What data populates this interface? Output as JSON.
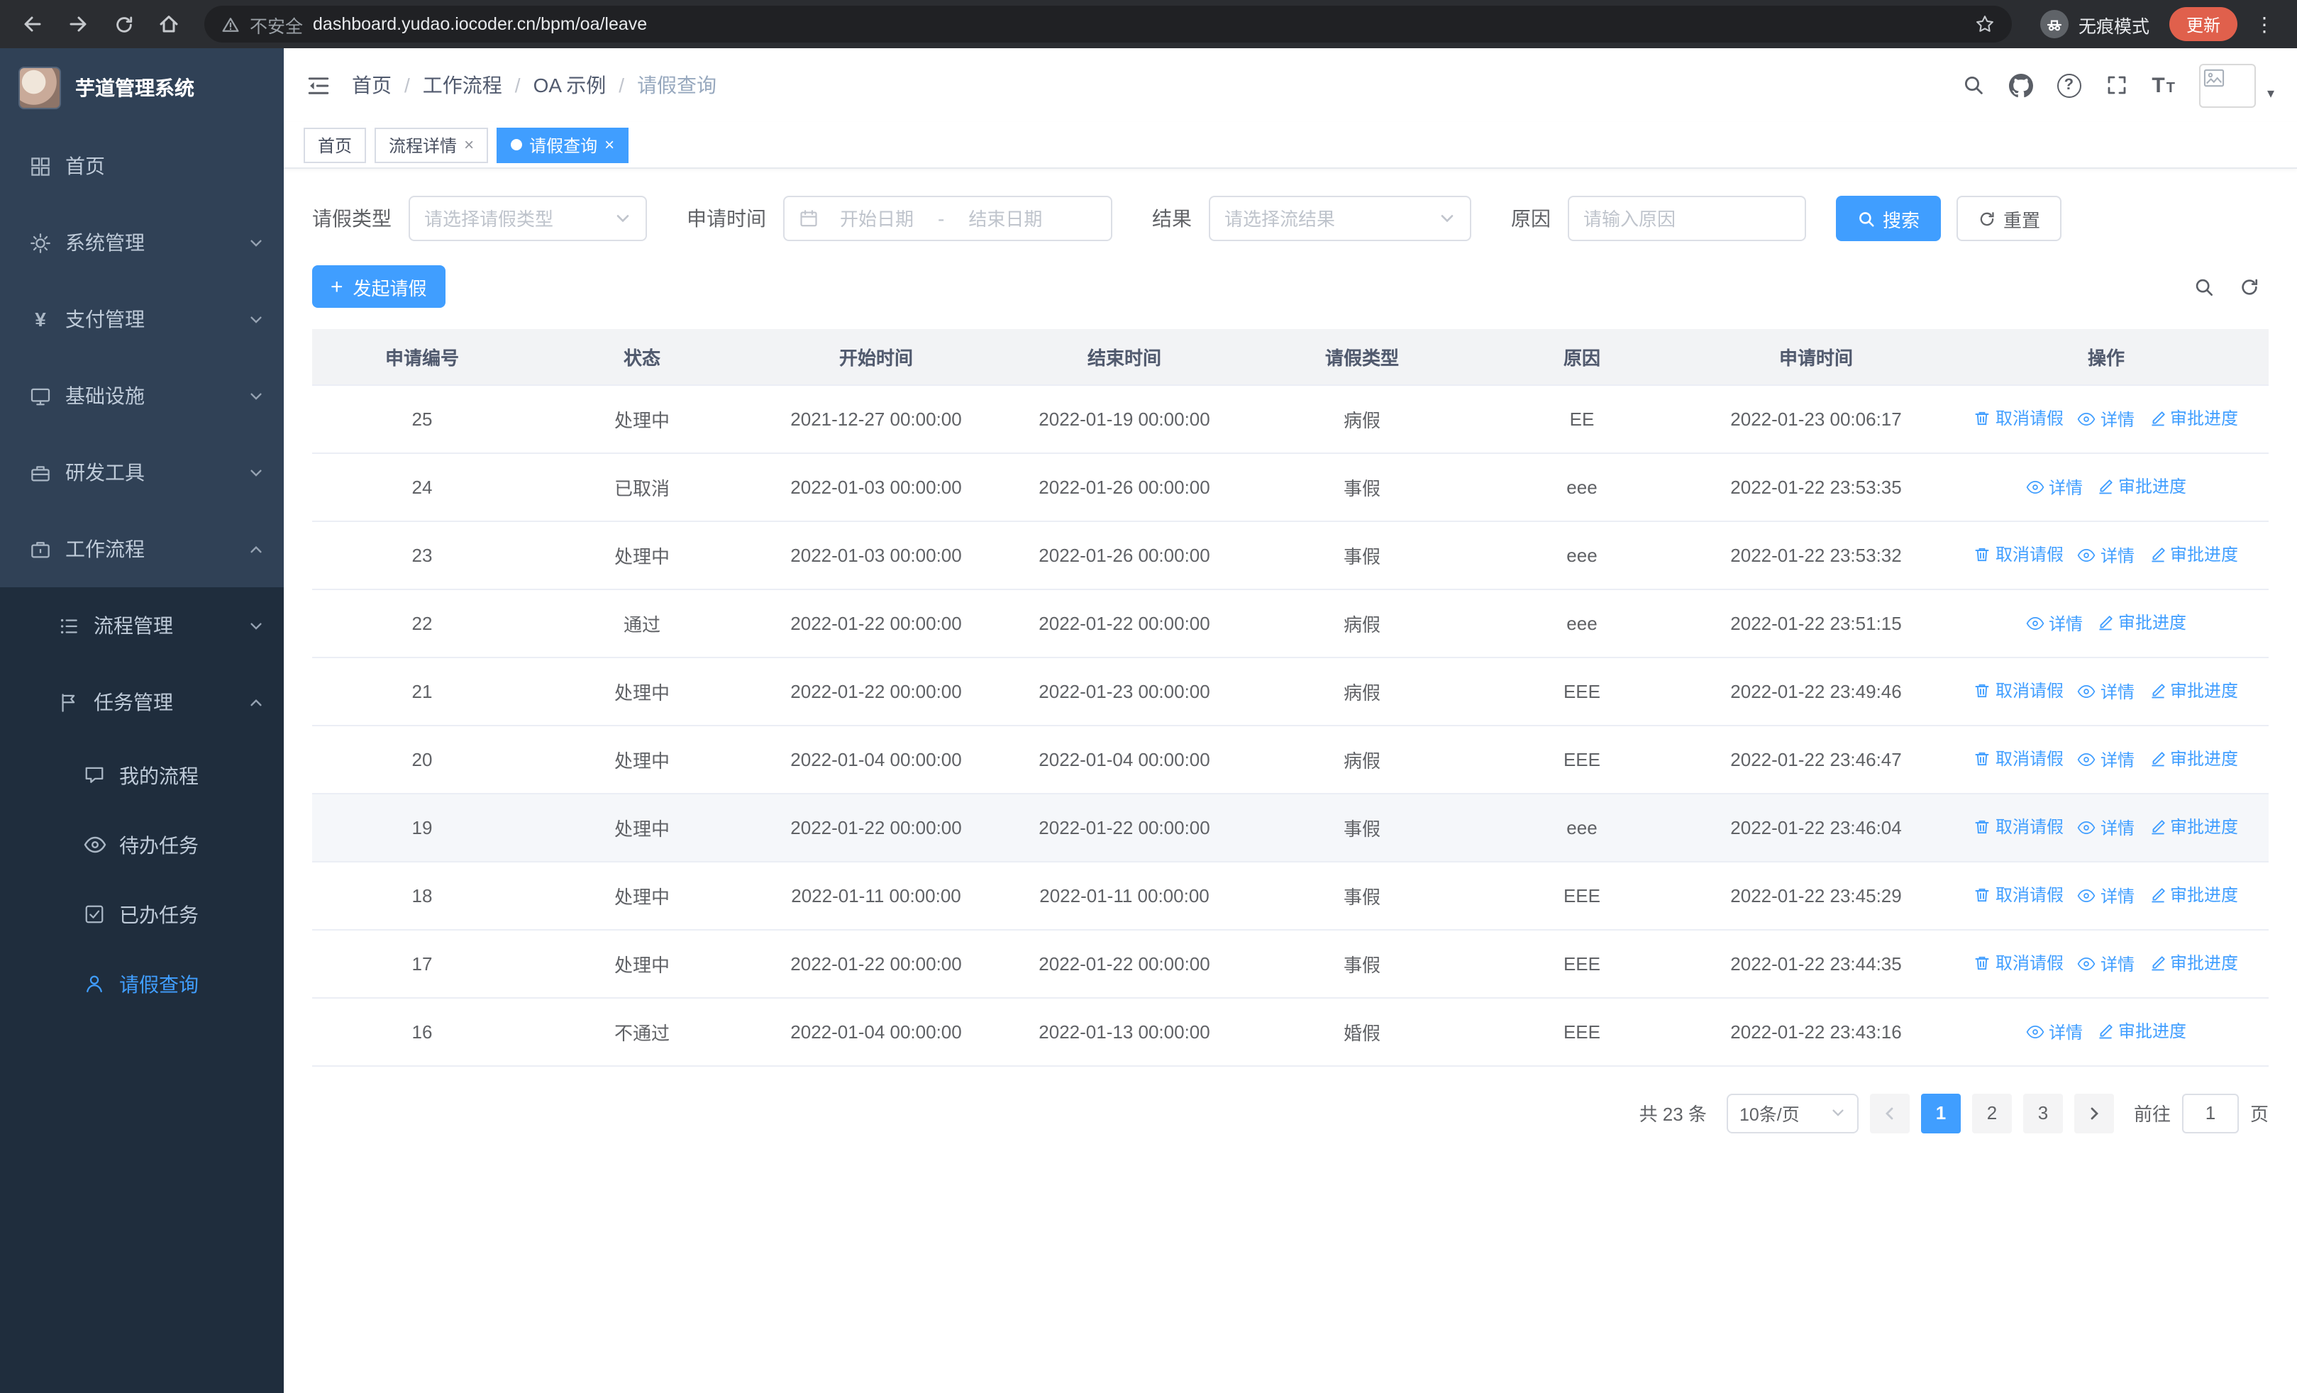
{
  "theme": {
    "primary": "#409eff",
    "sidebar_bg": "#304156",
    "sidebar_sub_bg": "#1f2d3d"
  },
  "icons": {
    "close": "×",
    "kebab": "⋮",
    "caret": "▾",
    "plus": "+",
    "question": "?",
    "yen": "¥",
    "font_large": "T",
    "font_small": "T"
  },
  "browser": {
    "security_warning": "不安全",
    "url": "dashboard.yudao.iocoder.cn/bpm/oa/leave",
    "incognito_label": "无痕模式",
    "update_button": "更新"
  },
  "sidebar": {
    "app_title": "芋道管理系统",
    "menu": [
      {
        "label": "首页"
      },
      {
        "label": "系统管理",
        "has_children": true
      },
      {
        "label": "支付管理",
        "has_children": true
      },
      {
        "label": "基础设施",
        "has_children": true
      },
      {
        "label": "研发工具",
        "has_children": true
      },
      {
        "label": "工作流程",
        "has_children": true,
        "expanded": true,
        "children": [
          {
            "label": "流程管理",
            "has_children": true
          },
          {
            "label": "任务管理",
            "has_children": true,
            "expanded": true,
            "children": [
              {
                "label": "我的流程"
              },
              {
                "label": "待办任务"
              },
              {
                "label": "已办任务"
              },
              {
                "label": "请假查询",
                "active": true
              }
            ]
          }
        ]
      }
    ]
  },
  "header": {
    "breadcrumb": [
      "首页",
      "工作流程",
      "OA 示例",
      "请假查询"
    ],
    "separator": "/"
  },
  "tabs": [
    {
      "label": "首页",
      "closable": false,
      "active": false
    },
    {
      "label": "流程详情",
      "closable": true,
      "active": false
    },
    {
      "label": "请假查询",
      "closable": true,
      "active": true
    }
  ],
  "filters": {
    "leave_type_label": "请假类型",
    "leave_type_placeholder": "请选择请假类型",
    "apply_time_label": "申请时间",
    "start_date_placeholder": "开始日期",
    "range_separator": "-",
    "end_date_placeholder": "结束日期",
    "result_label": "结果",
    "result_placeholder": "请选择流结果",
    "reason_label": "原因",
    "reason_placeholder": "请输入原因",
    "search_button": "搜索",
    "reset_button": "重置"
  },
  "toolbar": {
    "create_button": "发起请假"
  },
  "table": {
    "columns": [
      "申请编号",
      "状态",
      "开始时间",
      "结束时间",
      "请假类型",
      "原因",
      "申请时间",
      "操作"
    ],
    "action_labels": {
      "cancel": "取消请假",
      "detail": "详情",
      "progress": "审批进度"
    },
    "rows": [
      {
        "id": "25",
        "status": "处理中",
        "start": "2021-12-27 00:00:00",
        "end": "2022-01-19 00:00:00",
        "type": "病假",
        "reason": "EE",
        "apply_time": "2022-01-23 00:06:17",
        "actions": [
          "cancel",
          "detail",
          "progress"
        ],
        "highlighted": false
      },
      {
        "id": "24",
        "status": "已取消",
        "start": "2022-01-03 00:00:00",
        "end": "2022-01-26 00:00:00",
        "type": "事假",
        "reason": "eee",
        "apply_time": "2022-01-22 23:53:35",
        "actions": [
          "detail",
          "progress"
        ],
        "highlighted": false
      },
      {
        "id": "23",
        "status": "处理中",
        "start": "2022-01-03 00:00:00",
        "end": "2022-01-26 00:00:00",
        "type": "事假",
        "reason": "eee",
        "apply_time": "2022-01-22 23:53:32",
        "actions": [
          "cancel",
          "detail",
          "progress"
        ],
        "highlighted": false
      },
      {
        "id": "22",
        "status": "通过",
        "start": "2022-01-22 00:00:00",
        "end": "2022-01-22 00:00:00",
        "type": "病假",
        "reason": "eee",
        "apply_time": "2022-01-22 23:51:15",
        "actions": [
          "detail",
          "progress"
        ],
        "highlighted": false
      },
      {
        "id": "21",
        "status": "处理中",
        "start": "2022-01-22 00:00:00",
        "end": "2022-01-23 00:00:00",
        "type": "病假",
        "reason": "EEE",
        "apply_time": "2022-01-22 23:49:46",
        "actions": [
          "cancel",
          "detail",
          "progress"
        ],
        "highlighted": false
      },
      {
        "id": "20",
        "status": "处理中",
        "start": "2022-01-04 00:00:00",
        "end": "2022-01-04 00:00:00",
        "type": "病假",
        "reason": "EEE",
        "apply_time": "2022-01-22 23:46:47",
        "actions": [
          "cancel",
          "detail",
          "progress"
        ],
        "highlighted": false
      },
      {
        "id": "19",
        "status": "处理中",
        "start": "2022-01-22 00:00:00",
        "end": "2022-01-22 00:00:00",
        "type": "事假",
        "reason": "eee",
        "apply_time": "2022-01-22 23:46:04",
        "actions": [
          "cancel",
          "detail",
          "progress"
        ],
        "highlighted": true
      },
      {
        "id": "18",
        "status": "处理中",
        "start": "2022-01-11 00:00:00",
        "end": "2022-01-11 00:00:00",
        "type": "事假",
        "reason": "EEE",
        "apply_time": "2022-01-22 23:45:29",
        "actions": [
          "cancel",
          "detail",
          "progress"
        ],
        "highlighted": false
      },
      {
        "id": "17",
        "status": "处理中",
        "start": "2022-01-22 00:00:00",
        "end": "2022-01-22 00:00:00",
        "type": "事假",
        "reason": "EEE",
        "apply_time": "2022-01-22 23:44:35",
        "actions": [
          "cancel",
          "detail",
          "progress"
        ],
        "highlighted": false
      },
      {
        "id": "16",
        "status": "不通过",
        "start": "2022-01-04 00:00:00",
        "end": "2022-01-13 00:00:00",
        "type": "婚假",
        "reason": "EEE",
        "apply_time": "2022-01-22 23:43:16",
        "actions": [
          "detail",
          "progress"
        ],
        "highlighted": false
      }
    ]
  },
  "pagination": {
    "total_text": "共 23 条",
    "page_size": "10条/页",
    "pages": [
      "1",
      "2",
      "3"
    ],
    "active_page": "1",
    "goto_label": "前往",
    "goto_value": "1",
    "page_suffix": "页"
  }
}
